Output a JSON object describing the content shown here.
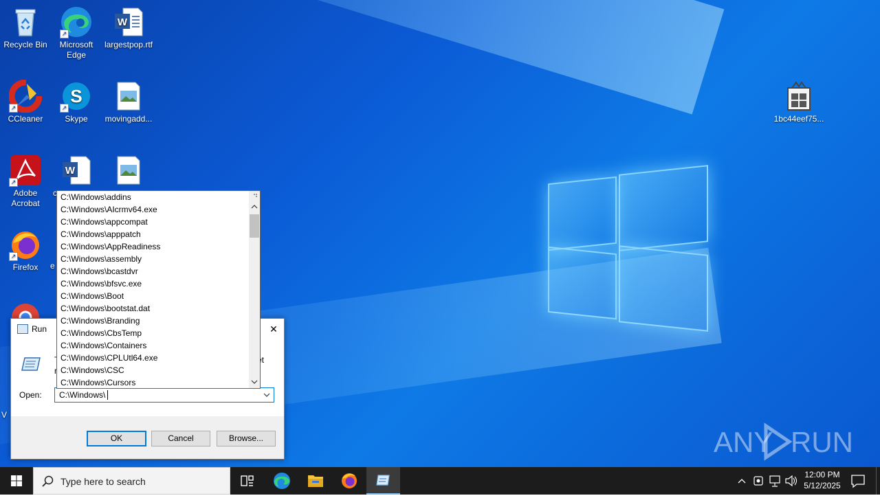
{
  "desktop": {
    "icons": [
      {
        "name": "icon-recycle-bin",
        "label": "Recycle Bin",
        "kind": "recycle-bin-icon"
      },
      {
        "name": "icon-microsoft-edge",
        "label": "Microsoft Edge",
        "kind": "edge-icon"
      },
      {
        "name": "icon-largestpop",
        "label": "largestpop.rtf",
        "kind": "word-document-icon"
      },
      {
        "name": "icon-ccleaner",
        "label": "CCleaner",
        "kind": "ccleaner-icon"
      },
      {
        "name": "icon-skype",
        "label": "Skype",
        "kind": "skype-icon"
      },
      {
        "name": "icon-movingadd",
        "label": "movingadd...",
        "kind": "image-file-icon"
      },
      {
        "name": "icon-adobe-acrobat",
        "label": "Adobe Acrobat",
        "kind": "acrobat-icon"
      },
      {
        "name": "icon-firefox",
        "label": "Firefox",
        "kind": "firefox-icon"
      },
      {
        "name": "icon-1bc44eef75",
        "label": "1bc44eef75...",
        "kind": "package-icon"
      }
    ],
    "partial_labels": {
      "c_label": "c",
      "e_label": "e",
      "v_label": "V"
    },
    "watermark": "ANY RUN"
  },
  "run_dialog": {
    "title": "Run",
    "description_fragment_left": "T",
    "description_fragment_left2": "r",
    "description_fragment_right": "et",
    "open_label": "Open:",
    "open_value": "C:\\Windows\\",
    "ok_label": "OK",
    "cancel_label": "Cancel",
    "browse_label": "Browse...",
    "close_glyph": "✕"
  },
  "autocomplete": {
    "items": [
      "C:\\Windows\\addins",
      "C:\\Windows\\AIcrmv64.exe",
      "C:\\Windows\\appcompat",
      "C:\\Windows\\apppatch",
      "C:\\Windows\\AppReadiness",
      "C:\\Windows\\assembly",
      "C:\\Windows\\bcastdvr",
      "C:\\Windows\\bfsvc.exe",
      "C:\\Windows\\Boot",
      "C:\\Windows\\bootstat.dat",
      "C:\\Windows\\Branding",
      "C:\\Windows\\CbsTemp",
      "C:\\Windows\\Containers",
      "C:\\Windows\\CPLUtl64.exe",
      "C:\\Windows\\CSC",
      "C:\\Windows\\Cursors"
    ]
  },
  "taskbar": {
    "search_placeholder": "Type here to search",
    "time": "12:00 PM",
    "date": "5/12/2025"
  },
  "colors": {
    "accent": "#0078d7",
    "taskbar": "#1c1c1c",
    "desktop": "#0b5bd6"
  }
}
